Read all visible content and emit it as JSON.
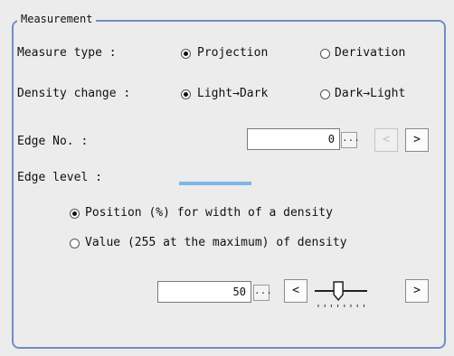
{
  "group": {
    "title": "Measurement"
  },
  "measure_type": {
    "label": "Measure type :",
    "options": [
      "Projection",
      "Derivation"
    ],
    "selected": "Projection"
  },
  "density_change": {
    "label": "Density change :",
    "options": [
      "Light→Dark",
      "Dark→Light"
    ],
    "selected": "Light→Dark"
  },
  "edge_no": {
    "label": "Edge No. :",
    "value": "0",
    "browse": "...",
    "prev": "<",
    "next": ">"
  },
  "edge_level": {
    "label": "Edge level :",
    "options": [
      "Position (%) for width of a density",
      "Value (255 at the maximum) of density"
    ],
    "selected": "Position (%) for width of a density",
    "value": "50",
    "browse": "...",
    "prev": "<",
    "next": ">",
    "slider_level": 0.45
  }
}
